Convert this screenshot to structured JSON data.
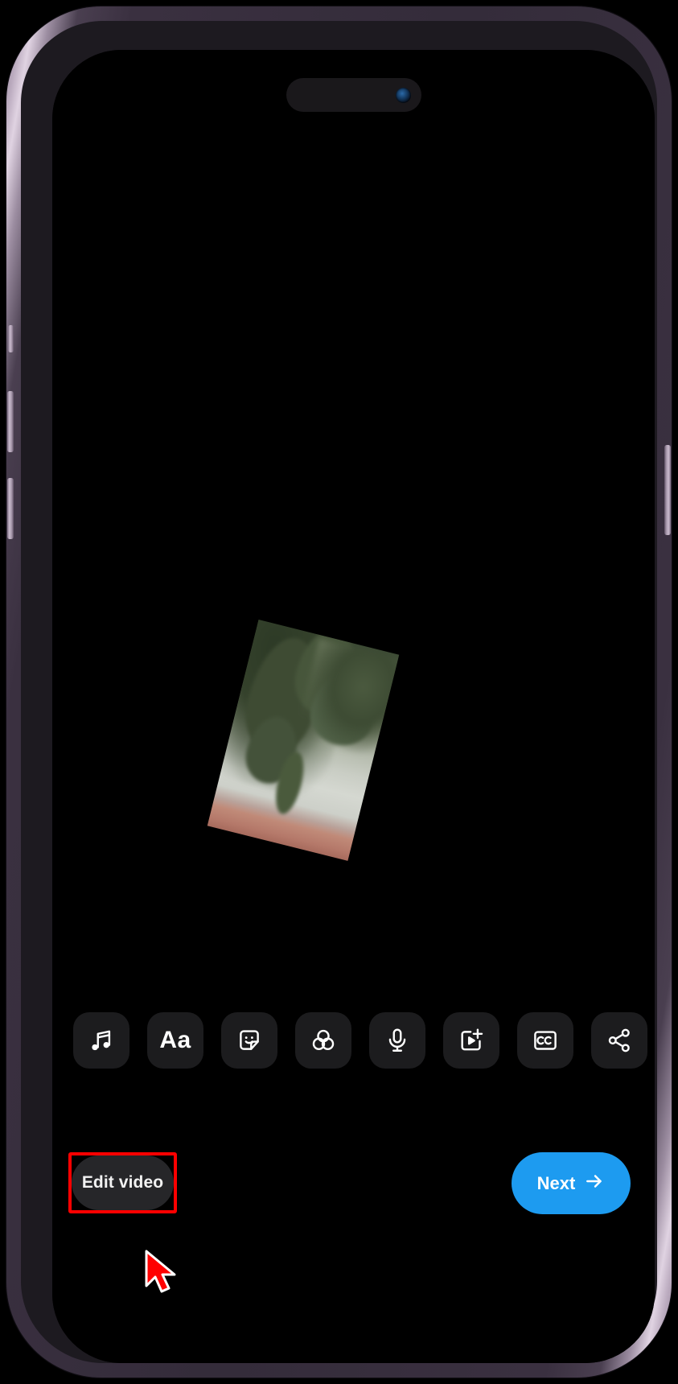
{
  "device": {
    "model_frame_color": "#a394a8",
    "screen_background": "#000000",
    "dynamic_island": {
      "camera_icon": "front-camera-icon"
    },
    "side_buttons": [
      "silent-switch",
      "volume-up-button",
      "volume-down-button",
      "power-button"
    ]
  },
  "app": {
    "screen_name": "video-composer",
    "video_preview": {
      "name": "rotated-video-thumbnail",
      "rotation_degrees": 14,
      "description": "tilted video clip preview"
    },
    "toolbar": {
      "name": "editor-toolbar",
      "items": [
        {
          "icon": "music-note-icon",
          "label": "Music"
        },
        {
          "icon": "text-aa-icon",
          "label": "Text"
        },
        {
          "icon": "sticker-icon",
          "label": "Stickers"
        },
        {
          "icon": "effects-circles-icon",
          "label": "Effects"
        },
        {
          "icon": "microphone-icon",
          "label": "Voiceover"
        },
        {
          "icon": "add-clip-icon",
          "label": "Add clip"
        },
        {
          "icon": "closed-captions-icon",
          "label": "Captions"
        },
        {
          "icon": "share-icon",
          "label": "Share"
        }
      ]
    },
    "bottom_bar": {
      "edit_video": {
        "label": "Edit video",
        "highlighted": true,
        "highlight_color": "#ff0000",
        "background_color": "#262629",
        "text_color": "#f2f2f2"
      },
      "next": {
        "label": "Next",
        "icon": "arrow-right-icon",
        "background_color": "#1d9bf0",
        "text_color": "#ffffff"
      }
    },
    "cursor": {
      "name": "mouse-cursor",
      "fill_color": "#ff0000",
      "outline_color": "#ffffff"
    }
  }
}
